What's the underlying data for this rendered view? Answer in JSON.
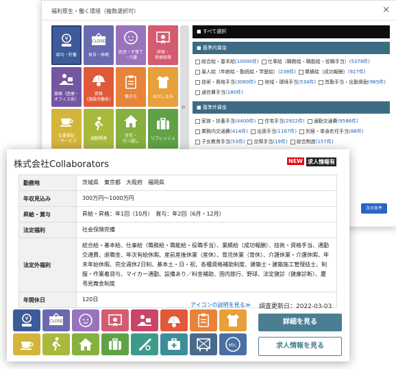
{
  "modal": {
    "title": "福利厚生・働く環境（複数選択可）",
    "close_label": "×",
    "tiles": [
      {
        "label": "給与・貯蓄",
        "color": "#3d5a9a",
        "icon": "yen-icon"
      },
      {
        "label": "休日・休暇",
        "color": "#6a6ab0",
        "icon": "close-sign-icon"
      },
      {
        "label": "託児・子育て\n・介護",
        "color": "#9a73bd",
        "icon": "baby-icon"
      },
      {
        "label": "研修・\n資格取得",
        "color": "#d45b70",
        "icon": "certificate-icon"
      },
      {
        "label": "賞格（医療・\nオフィス系）",
        "color": "#7556a2",
        "icon": "office-worker-icon"
      },
      {
        "label": "資格\n(施設労働系)",
        "color": "#e05a3a",
        "icon": "helmet-icon"
      },
      {
        "label": "働き方",
        "color": "#e8833a",
        "icon": "clipboard-icon"
      },
      {
        "label": "おだしなみ",
        "color": "#e8a03a",
        "icon": "shirt-icon"
      },
      {
        "label": "企業福祉\n・サービス",
        "color": "#d4b53b",
        "icon": "coffee-icon"
      },
      {
        "label": "通勤関連",
        "color": "#a9b93c",
        "icon": "walking-person-icon"
      },
      {
        "label": "住宅・\n引っ越し",
        "color": "#86b03f",
        "icon": "house-icon"
      },
      {
        "label": "リフレッシュ",
        "color": "#5fa246",
        "icon": "suitcase-icon"
      }
    ],
    "select_all": "■ すべて選択",
    "sections": [
      {
        "title": "■ 基準内賃金",
        "options": [
          {
            "label": "総合給・基本給",
            "count": "(10000件)"
          },
          {
            "label": "仕事給（職務給・職能給・役職手当）",
            "count": "(5378件)"
          },
          {
            "label": "属人給（年齢給・勤続給・学歴給）",
            "count": "(238件)"
          },
          {
            "label": "業績給（成功報酬）",
            "count": "(927件)"
          },
          {
            "label": "技術・資格手当",
            "count": "(3080件)"
          },
          {
            "label": "地域・環境手当",
            "count": "(534件)"
          },
          {
            "label": "皆勤手当・出勤奨励",
            "count": "(965件)"
          },
          {
            "label": "通信費手当",
            "count": "(180件)"
          }
        ]
      },
      {
        "title": "■ 基準外賃金",
        "options": [
          {
            "label": "家族・扶養手当",
            "count": "(4400件)"
          },
          {
            "label": "住宅手当",
            "count": "(2922件)"
          },
          {
            "label": "通勤交通費",
            "count": "(9586件)"
          },
          {
            "label": "業務内交通費",
            "count": "(414件)"
          },
          {
            "label": "出張手当",
            "count": "(1167件)"
          },
          {
            "label": "別居・単身赴任手当",
            "count": "(88件)"
          },
          {
            "label": "子女教育手当",
            "count": "(53件)"
          },
          {
            "label": "交際手当",
            "count": "(19件)"
          },
          {
            "label": "総合制度",
            "count": "(157件)"
          }
        ]
      }
    ],
    "next_button": "次の条件"
  },
  "card": {
    "company": "株式会社Collaborators",
    "badge_new": "NEW",
    "badge_ad": "求人情報有",
    "rows": [
      {
        "label": "勤務地",
        "value": "茨城県　東京都　大阪府　福岡県"
      },
      {
        "label": "年収見込み",
        "value": "300万円〜1000万円"
      },
      {
        "label": "昇給・賞与",
        "value": "昇給・昇格：年1回（10月）　賞与：年2回（6月・12月）"
      },
      {
        "label": "法定福利",
        "value": "社会保険完備"
      },
      {
        "label": "法定外福利",
        "value": "総合給・基本給、仕事給（職務給・職能給・役職手当）、業績給（成功報酬）、技術・資格手当、通勤交通費、退職金、年次有給休暇、産前産後休業（産休）、育児休業（育休）、介護休業・介護休暇、年末年始休暇、完全週休2日制、基本土・日・祝、各種資格補助制度、建築士・建築施工管理技士、制服・作業着貸与、マイカー通勤、設備あり／料金補助、国内旅行、野球、法定健診（健康診断）、慶弔見舞金制度"
      },
      {
        "label": "年間休日",
        "value": "120日"
      }
    ],
    "icon_help": "アイコンの説明を見る≫",
    "updated": "調査更新日：2022-03-03",
    "detail_button": "詳細を見る",
    "job_button": "求人情報を見る",
    "icons": [
      {
        "name": "yen-icon",
        "color": "#3d5a9a"
      },
      {
        "name": "close-sign-icon",
        "color": "#6a6ab0"
      },
      {
        "name": "baby-icon",
        "color": "#9a73bd"
      },
      {
        "name": "certificate-icon",
        "color": "#d45b70"
      },
      {
        "name": "office-worker-icon",
        "color": "#c9466a"
      },
      {
        "name": "helmet-icon",
        "color": "#e05a3a"
      },
      {
        "name": "clipboard-icon",
        "color": "#e8833a"
      },
      {
        "name": "shirt-icon",
        "color": "#e8a03a"
      },
      {
        "name": "coffee-icon",
        "color": "#d4b53b"
      },
      {
        "name": "walking-person-icon",
        "color": "#a9b93c"
      },
      {
        "name": "house-icon",
        "color": "#86b03f"
      },
      {
        "name": "suitcase-icon",
        "color": "#5fa246"
      },
      {
        "name": "baseball-bat-icon",
        "color": "#3e9a8d"
      },
      {
        "name": "first-aid-kit-icon",
        "color": "#3d8d9a"
      },
      {
        "name": "notice-board-icon",
        "color": "#4a6a8d"
      },
      {
        "name": "etc-icon",
        "color": "#4a6fa5",
        "text": "etc."
      }
    ]
  }
}
